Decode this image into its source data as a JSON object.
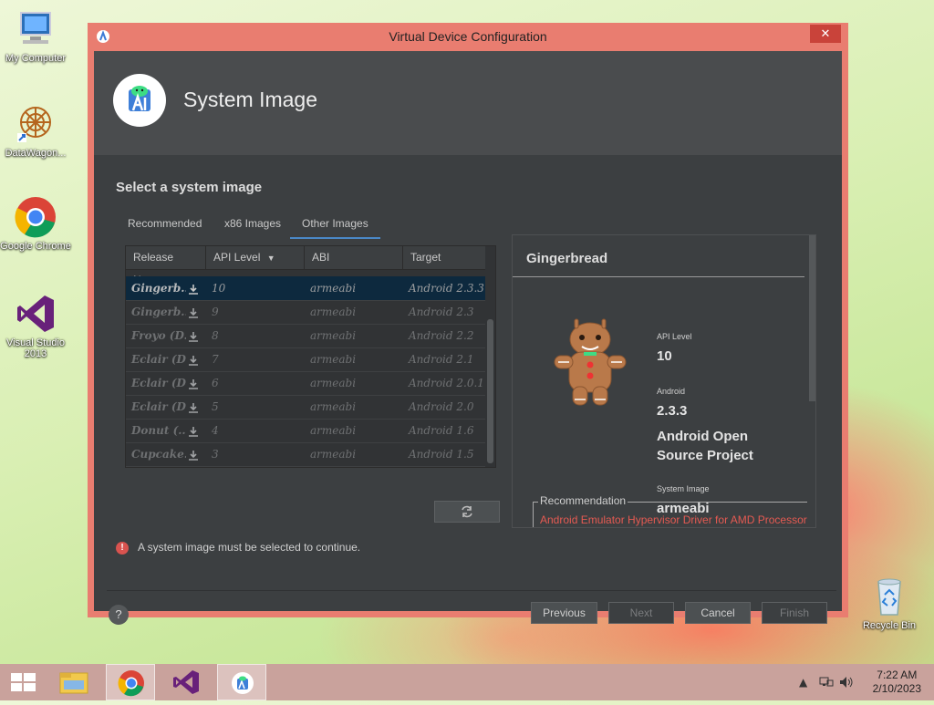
{
  "desktop": {
    "icons": [
      {
        "label": "My Computer"
      },
      {
        "label": "DataWagon..."
      },
      {
        "label": "Google Chrome"
      },
      {
        "label": "Visual Studio 2013"
      },
      {
        "label": "Recycle Bin"
      }
    ]
  },
  "window": {
    "title": "Virtual Device Configuration",
    "close_glyph": "✕",
    "header_title": "System Image",
    "section_title": "Select a system image",
    "tabs": [
      {
        "label": "Recommended",
        "active": false
      },
      {
        "label": "x86 Images",
        "active": false
      },
      {
        "label": "Other Images",
        "active": true
      }
    ],
    "table": {
      "headers": [
        "Release Name",
        "API Level",
        "ABI",
        "Target"
      ],
      "sort_glyph": "▼",
      "rows": [
        {
          "name": "Gingerb...",
          "api": "10",
          "abi": "armeabi",
          "target": "Android 2.3.3",
          "selected": true
        },
        {
          "name": "Gingerb...",
          "api": "9",
          "abi": "armeabi",
          "target": "Android 2.3",
          "selected": false
        },
        {
          "name": "Froyo (D...",
          "api": "8",
          "abi": "armeabi",
          "target": "Android 2.2",
          "selected": false
        },
        {
          "name": "Eclair (D...",
          "api": "7",
          "abi": "armeabi",
          "target": "Android 2.1",
          "selected": false
        },
        {
          "name": "Eclair (D...",
          "api": "6",
          "abi": "armeabi",
          "target": "Android 2.0.1",
          "selected": false
        },
        {
          "name": "Eclair (D...",
          "api": "5",
          "abi": "armeabi",
          "target": "Android 2.0",
          "selected": false
        },
        {
          "name": "Donut (...",
          "api": "4",
          "abi": "armeabi",
          "target": "Android 1.6",
          "selected": false
        },
        {
          "name": "Cupcake...",
          "api": "3",
          "abi": "armeabi",
          "target": "Android 1.5",
          "selected": false
        }
      ]
    },
    "error_icon": "!",
    "error_message": "A system image must be selected to continue.",
    "details": {
      "title": "Gingerbread",
      "api_level_label": "API Level",
      "api_level_value": "10",
      "android_label": "Android",
      "android_version": "2.3.3",
      "vendor": "Android Open Source Project",
      "system_image_label": "System Image",
      "system_image_value": "armeabi",
      "recommendation_title": "Recommendation",
      "recommendation_link": "Android Emulator Hypervisor Driver for AMD Processor"
    },
    "help_glyph": "?",
    "buttons": {
      "previous": "Previous",
      "next": "Next",
      "cancel": "Cancel",
      "finish": "Finish"
    }
  },
  "taskbar": {
    "time": "7:22 AM",
    "date": "2/10/2023"
  }
}
